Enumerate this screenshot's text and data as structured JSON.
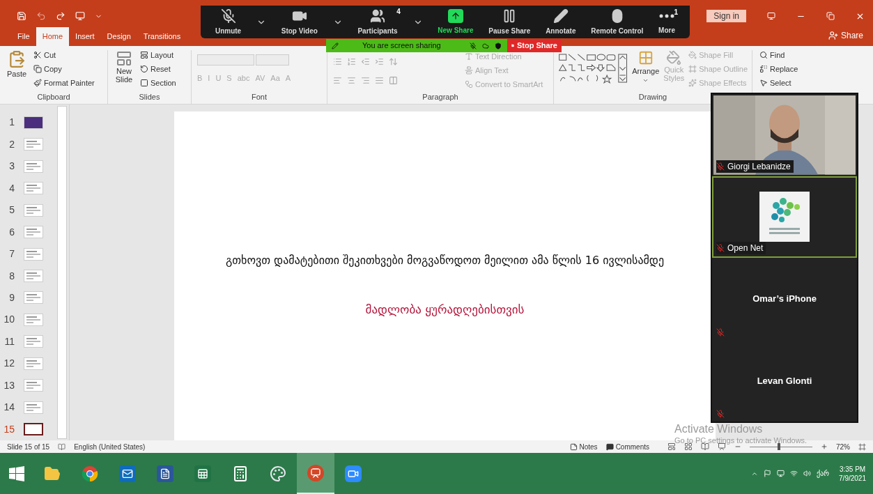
{
  "title_bar": {
    "sign_in": "Sign in",
    "share": "Share"
  },
  "tabs": [
    {
      "label": "File",
      "selected": false
    },
    {
      "label": "Home",
      "selected": true
    },
    {
      "label": "Insert",
      "selected": false
    },
    {
      "label": "Design",
      "selected": false
    },
    {
      "label": "Transitions",
      "selected": false
    }
  ],
  "ribbon": {
    "clipboard": {
      "label": "Clipboard",
      "paste": "Paste",
      "items": [
        "Cut",
        "Copy",
        "Format Painter"
      ]
    },
    "slides": {
      "label": "Slides",
      "new_slide": "New Slide",
      "items": [
        "Layout",
        "Reset",
        "Section"
      ]
    },
    "font": {
      "label": "Font",
      "buttons": [
        "B",
        "I",
        "U",
        "S",
        "abc",
        "AV",
        "Aa",
        "A"
      ]
    },
    "paragraph": {
      "label": "Paragraph",
      "items": [
        "Text Direction",
        "Align Text",
        "Convert to SmartArt"
      ]
    },
    "drawing": {
      "label": "Drawing",
      "arrange": "Arrange",
      "quick_styles": "Quick Styles",
      "items": [
        "Shape Fill",
        "Shape Outline",
        "Shape Effects"
      ]
    },
    "editing": {
      "items": [
        "Find",
        "Replace",
        "Select"
      ]
    }
  },
  "meeting_toolbar": [
    {
      "label": "Unmute",
      "kind": "mic",
      "caret": true
    },
    {
      "label": "Stop Video",
      "kind": "video",
      "caret": true
    },
    {
      "label": "Participants",
      "kind": "participants",
      "caret": true,
      "badge": "4"
    },
    {
      "label": "New Share",
      "kind": "share",
      "caret": false
    },
    {
      "label": "Pause Share",
      "kind": "pause",
      "caret": false
    },
    {
      "label": "Annotate",
      "kind": "annotate",
      "caret": false
    },
    {
      "label": "Remote Control",
      "kind": "remote",
      "caret": false
    },
    {
      "label": "More",
      "kind": "more",
      "caret": false,
      "badge": "1"
    }
  ],
  "sharing_bar": {
    "message": "You are screen sharing",
    "stop": "Stop Share"
  },
  "thumbnails": [
    {
      "number": "1",
      "kind": "title",
      "selected": false
    },
    {
      "number": "2",
      "kind": "content",
      "selected": false
    },
    {
      "number": "3",
      "kind": "content",
      "selected": false
    },
    {
      "number": "4",
      "kind": "content",
      "selected": false
    },
    {
      "number": "5",
      "kind": "content",
      "selected": false
    },
    {
      "number": "6",
      "kind": "content",
      "selected": false
    },
    {
      "number": "7",
      "kind": "content",
      "selected": false
    },
    {
      "number": "8",
      "kind": "content",
      "selected": false
    },
    {
      "number": "9",
      "kind": "content",
      "selected": false
    },
    {
      "number": "10",
      "kind": "content",
      "selected": false
    },
    {
      "number": "11",
      "kind": "content",
      "selected": false
    },
    {
      "number": "12",
      "kind": "content",
      "selected": false
    },
    {
      "number": "13",
      "kind": "content",
      "selected": false
    },
    {
      "number": "14",
      "kind": "content",
      "selected": false
    },
    {
      "number": "15",
      "kind": "blank",
      "selected": true
    }
  ],
  "slide": {
    "body": "გთხოვთ დამატებითი შეკითხვები მოგვაწოდოთ მეილით ამა წლის 16 ივლისამდე",
    "thanks": "მადლობა ყურადღებისთვის"
  },
  "participants": [
    {
      "name": "Giorgi Lebanidze",
      "kind": "video",
      "muted": true,
      "active": false
    },
    {
      "name": "Open Net",
      "kind": "logo",
      "muted": true,
      "active": true
    },
    {
      "name": "Omar’s iPhone",
      "kind": "name",
      "muted": true,
      "active": false
    },
    {
      "name": "Levan Glonti",
      "kind": "name",
      "muted": true,
      "active": false
    }
  ],
  "activation": {
    "title": "Activate Windows",
    "hint": "Go to PC settings to activate Windows."
  },
  "status_bar": {
    "slide_info": "Slide 15 of 15",
    "language": "English (United States)",
    "notes": "Notes",
    "comments": "Comments",
    "zoom": {
      "level": 0.45,
      "reading": "72%"
    }
  },
  "taskbar": {
    "apps": [
      {
        "kind": "explorer",
        "active": false
      },
      {
        "kind": "chrome",
        "active": false
      },
      {
        "kind": "outlook",
        "active": false
      },
      {
        "kind": "word",
        "active": false
      },
      {
        "kind": "excel",
        "active": false
      },
      {
        "kind": "calculator",
        "active": false
      },
      {
        "kind": "paint",
        "active": false
      },
      {
        "kind": "powerpoint",
        "active": true
      },
      {
        "kind": "zoom",
        "active": false
      }
    ],
    "keyboard": "ქარ",
    "time": "3:35 PM",
    "date": "7/9/2021"
  }
}
